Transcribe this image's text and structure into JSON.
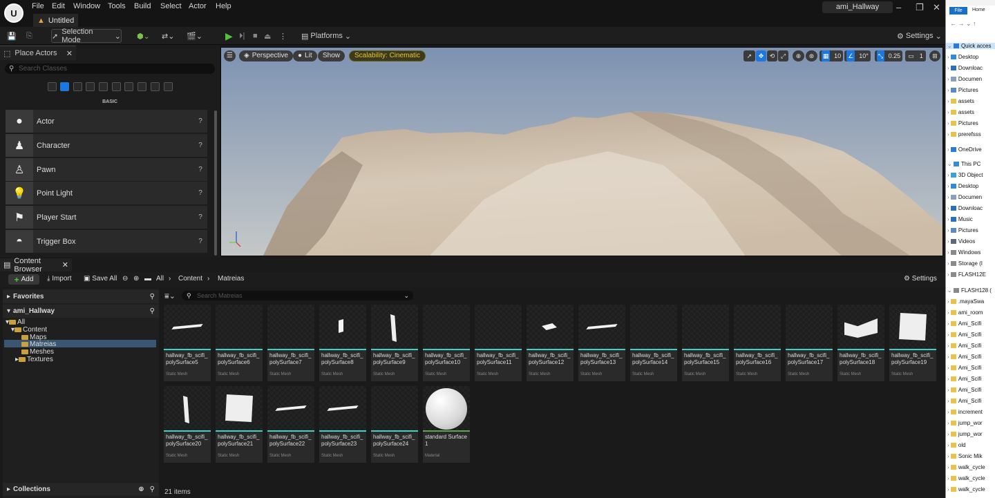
{
  "menu": [
    "File",
    "Edit",
    "Window",
    "Tools",
    "Build",
    "Select",
    "Actor",
    "Help"
  ],
  "doc_tab": "Untitled",
  "project": "ami_Hallway",
  "toolbar": {
    "selection_mode": "Selection Mode",
    "platforms": "Platforms",
    "settings": "Settings"
  },
  "place_actors": {
    "tab": "Place Actors",
    "search_placeholder": "Search Classes",
    "category": "BASIC",
    "items": [
      {
        "label": "Actor",
        "icon": "sphere-icon"
      },
      {
        "label": "Character",
        "icon": "character-icon"
      },
      {
        "label": "Pawn",
        "icon": "pawn-icon"
      },
      {
        "label": "Point Light",
        "icon": "light-bulb-icon"
      },
      {
        "label": "Player Start",
        "icon": "flag-icon"
      },
      {
        "label": "Trigger Box",
        "icon": "box-icon"
      }
    ]
  },
  "viewport": {
    "perspective": "Perspective",
    "lit": "Lit",
    "show": "Show",
    "scalability": "Scalability: Cinematic",
    "grid_snap": "10",
    "rot_snap": "10°",
    "scale_snap": "0.25",
    "camera_speed": "1",
    "colors": {
      "sky_top": "#8a9bb6",
      "sky_bottom": "#bcc2c6",
      "terrain": "#c7b7a3"
    }
  },
  "content_browser": {
    "tab": "Content Browser",
    "add": "Add",
    "import": "Import",
    "save_all": "Save All",
    "path": [
      "All",
      "Content",
      "Matreias"
    ],
    "settings": "Settings",
    "favorites": "Favorites",
    "project": "ami_Hallway",
    "tree": [
      "All",
      "Content",
      "Maps",
      "Matreias",
      "Meshes",
      "Textures"
    ],
    "filter_placeholder": "Search Matreias",
    "collections": "Collections",
    "item_count": "21 items",
    "assets": [
      {
        "name": "hallway_fb_scifi_polySurface5",
        "type": "Static Mesh",
        "shape": "flat"
      },
      {
        "name": "hallway_fb_scifi_polySurface6",
        "type": "Static Mesh",
        "shape": "none"
      },
      {
        "name": "hallway_fb_scifi_polySurface7",
        "type": "Static Mesh",
        "shape": "none"
      },
      {
        "name": "hallway_fb_scifi_polySurface8",
        "type": "Static Mesh",
        "shape": "small-panel"
      },
      {
        "name": "hallway_fb_scifi_polySurface9",
        "type": "Static Mesh",
        "shape": "tall-panel"
      },
      {
        "name": "hallway_fb_scifi_polySurface10",
        "type": "Static Mesh",
        "shape": "none"
      },
      {
        "name": "hallway_fb_scifi_polySurface11",
        "type": "Static Mesh",
        "shape": "none"
      },
      {
        "name": "hallway_fb_scifi_polySurface12",
        "type": "Static Mesh",
        "shape": "small-flat"
      },
      {
        "name": "hallway_fb_scifi_polySurface13",
        "type": "Static Mesh",
        "shape": "flat"
      },
      {
        "name": "hallway_fb_scifi_polySurface14",
        "type": "Static Mesh",
        "shape": "none"
      },
      {
        "name": "hallway_fb_scifi_polySurface15",
        "type": "Static Mesh",
        "shape": "none"
      },
      {
        "name": "hallway_fb_scifi_polySurface16",
        "type": "Static Mesh",
        "shape": "none"
      },
      {
        "name": "hallway_fb_scifi_polySurface17",
        "type": "Static Mesh",
        "shape": "none"
      },
      {
        "name": "hallway_fb_scifi_polySurface18",
        "type": "Static Mesh",
        "shape": "corner"
      },
      {
        "name": "hallway_fb_scifi_polySurface19",
        "type": "Static Mesh",
        "shape": "square"
      },
      {
        "name": "hallway_fb_scifi_polySurface20",
        "type": "Static Mesh",
        "shape": "tall-panel"
      },
      {
        "name": "hallway_fb_scifi_polySurface21",
        "type": "Static Mesh",
        "shape": "square"
      },
      {
        "name": "hallway_fb_scifi_polySurface22",
        "type": "Static Mesh",
        "shape": "flat"
      },
      {
        "name": "hallway_fb_scifi_polySurface23",
        "type": "Static Mesh",
        "shape": "flat"
      },
      {
        "name": "hallway_fb_scifi_polySurface24",
        "type": "Static Mesh",
        "shape": "none"
      },
      {
        "name": "standard Surface1",
        "type": "Material",
        "shape": "sphere"
      }
    ]
  },
  "explorer": {
    "tabs": [
      "File",
      "Home"
    ],
    "items": [
      {
        "label": "Quick acces",
        "icon": "star-icon"
      },
      {
        "label": "Desktop",
        "icon": "desktop-icon"
      },
      {
        "label": "Downloac",
        "icon": "download-icon"
      },
      {
        "label": "Documen",
        "icon": "document-icon"
      },
      {
        "label": "Pictures",
        "icon": "pictures-icon"
      },
      {
        "label": "assets",
        "icon": "folder-icon"
      },
      {
        "label": "assets",
        "icon": "folder-icon"
      },
      {
        "label": "Pictures",
        "icon": "folder-icon"
      },
      {
        "label": "prerefsss",
        "icon": "folder-icon"
      },
      {
        "label": "OneDrive",
        "icon": "cloud-icon"
      },
      {
        "label": "This PC",
        "icon": "pc-icon"
      },
      {
        "label": "3D Object",
        "icon": "cube-icon"
      },
      {
        "label": "Desktop",
        "icon": "desktop-icon"
      },
      {
        "label": "Documen",
        "icon": "document-icon"
      },
      {
        "label": "Downloac",
        "icon": "download-icon"
      },
      {
        "label": "Music",
        "icon": "music-icon"
      },
      {
        "label": "Pictures",
        "icon": "pictures-icon"
      },
      {
        "label": "Videos",
        "icon": "video-icon"
      },
      {
        "label": "Windows",
        "icon": "drive-icon"
      },
      {
        "label": "Storage (I",
        "icon": "drive-icon"
      },
      {
        "label": "FLASH12E",
        "icon": "drive-icon"
      },
      {
        "label": "FLASH128 (",
        "icon": "drive-icon"
      },
      {
        "label": ".mayaSwa",
        "icon": "folder-icon"
      },
      {
        "label": "ami_room",
        "icon": "folder-icon"
      },
      {
        "label": "Ami_Scifi",
        "icon": "folder-icon"
      },
      {
        "label": "Ami_Scifi",
        "icon": "folder-icon"
      },
      {
        "label": "Ami_Scifi",
        "icon": "folder-icon"
      },
      {
        "label": "Ami_Scifi",
        "icon": "folder-icon"
      },
      {
        "label": "Ami_Scifi",
        "icon": "folder-icon"
      },
      {
        "label": "Ami_Scifi",
        "icon": "folder-icon"
      },
      {
        "label": "Ami_Scifi",
        "icon": "folder-icon"
      },
      {
        "label": "Ami_Scifi",
        "icon": "folder-icon"
      },
      {
        "label": "increment",
        "icon": "folder-icon"
      },
      {
        "label": "jump_wor",
        "icon": "folder-icon"
      },
      {
        "label": "jump_wor",
        "icon": "folder-icon"
      },
      {
        "label": "old",
        "icon": "folder-icon"
      },
      {
        "label": "Sonic Mik",
        "icon": "folder-icon"
      },
      {
        "label": "walk_cycle",
        "icon": "folder-icon"
      },
      {
        "label": "walk_cycle",
        "icon": "folder-icon"
      },
      {
        "label": "walk_cycle",
        "icon": "folder-icon"
      }
    ]
  }
}
